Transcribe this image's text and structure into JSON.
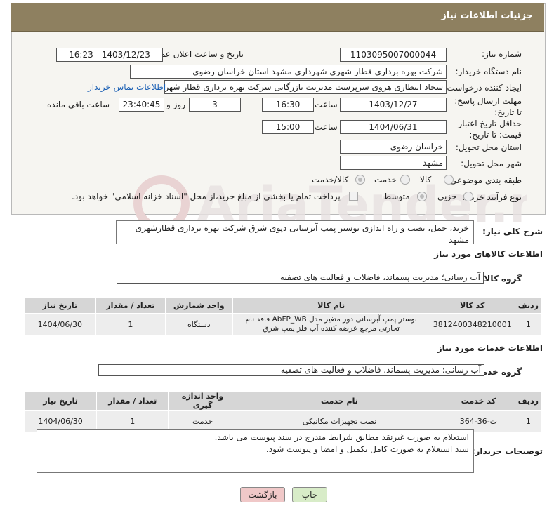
{
  "header": {
    "title": "جزئیات اطلاعات نیاز"
  },
  "form": {
    "need_number_label": "شماره نیاز:",
    "need_number": "1103095007000044",
    "announce_label": "تاریخ و ساعت اعلان عمومی:",
    "announce_value": "1403/12/23 - 16:23",
    "buyer_org_label": "نام دستگاه خریدار:",
    "buyer_org": "شرکت بهره برداری قطار شهری شهرداری مشهد استان خراسان رضوی",
    "requester_label": "ایجاد کننده درخواست:",
    "requester": "سجاد انتظاری هروی سرپرست مدیریت بازرگانی شرکت بهره برداری قطار شهری",
    "contact_link": "اطلاعات تماس خریدار",
    "deadline_label": "مهلت ارسال پاسخ: تا تاریخ:",
    "deadline_date": "1403/12/27",
    "time_label": "ساعت",
    "deadline_time": "16:30",
    "days_value": "3",
    "days_label": "روز و",
    "remaining_time": "23:40:45",
    "remaining_label": "ساعت باقی مانده",
    "validity_label": "حداقل تاریخ اعتبار قیمت: تا تاریخ:",
    "validity_date": "1404/06/31",
    "validity_time": "15:00",
    "province_label": "استان محل تحویل:",
    "province": "خراسان رضوی",
    "city_label": "شهر محل تحویل:",
    "city": "مشهد",
    "category_label": "طبقه بندی موضوعی:",
    "category_options": [
      "کالا",
      "خدمت",
      "کالا/خدمت"
    ],
    "purchase_type_label": "نوع فرآیند خرید :",
    "purchase_options": [
      "جزیی",
      "متوسط"
    ],
    "payment_note": "پرداخت تمام یا بخشی از مبلغ خرید،از محل \"اسناد خزانه اسلامی\" خواهد بود."
  },
  "summary": {
    "label": "شرح کلی نیاز:",
    "text": "خرید، حمل، نصب و راه اندازی بوستر پمپ آبرسانی دپوی شرق شرکت بهره برداری قطارشهری مشهد"
  },
  "goods": {
    "section_title": "اطلاعات کالاهای مورد نیاز",
    "group_label": "گروه کالا:",
    "group_value": "آب رسانی؛ مدیریت پسماند، فاضلاب و فعالیت های تصفیه",
    "columns": [
      "ردیف",
      "کد کالا",
      "نام کالا",
      "واحد شمارش",
      "تعداد / مقدار",
      "تاریخ نیاز"
    ],
    "rows": [
      [
        "1",
        "3812400348210001",
        "بوستر پمپ آبرسانی دور متغیر مدل AbFP_WB فاقد نام تجارتی مرجع عرضه کننده آب فلز پمپ شرق",
        "دستگاه",
        "1",
        "1404/06/30"
      ]
    ]
  },
  "services": {
    "section_title": "اطلاعات خدمات مورد نیاز",
    "group_label": "گروه خدمت:",
    "group_value": "آب رسانی؛ مدیریت پسماند، فاضلاب و فعالیت های تصفیه",
    "columns": [
      "ردیف",
      "کد خدمت",
      "نام خدمت",
      "واحد اندازه گیری",
      "تعداد / مقدار",
      "تاریخ نیاز"
    ],
    "rows": [
      [
        "1",
        "ث-36-364",
        "نصب تجهیزات مکانیکی",
        "خدمت",
        "1",
        "1404/06/30"
      ]
    ]
  },
  "buyer_notes": {
    "label": "توضیحات خریدار:",
    "line1": "استعلام به صورت غیرنقد مطابق شرایط مندرج در سند پیوست می باشد.",
    "line2": "سند استعلام به صورت کامل تکمیل و امضا و پیوست شود."
  },
  "buttons": {
    "print": "چاپ",
    "back": "بازگشت"
  },
  "watermark": {
    "text": "AriaTender.net"
  },
  "colors": {
    "header_bg": "#8e8060",
    "link": "#1a5fb4",
    "back_btn": "#f0c8c8",
    "print_btn": "#d8ecc8"
  }
}
